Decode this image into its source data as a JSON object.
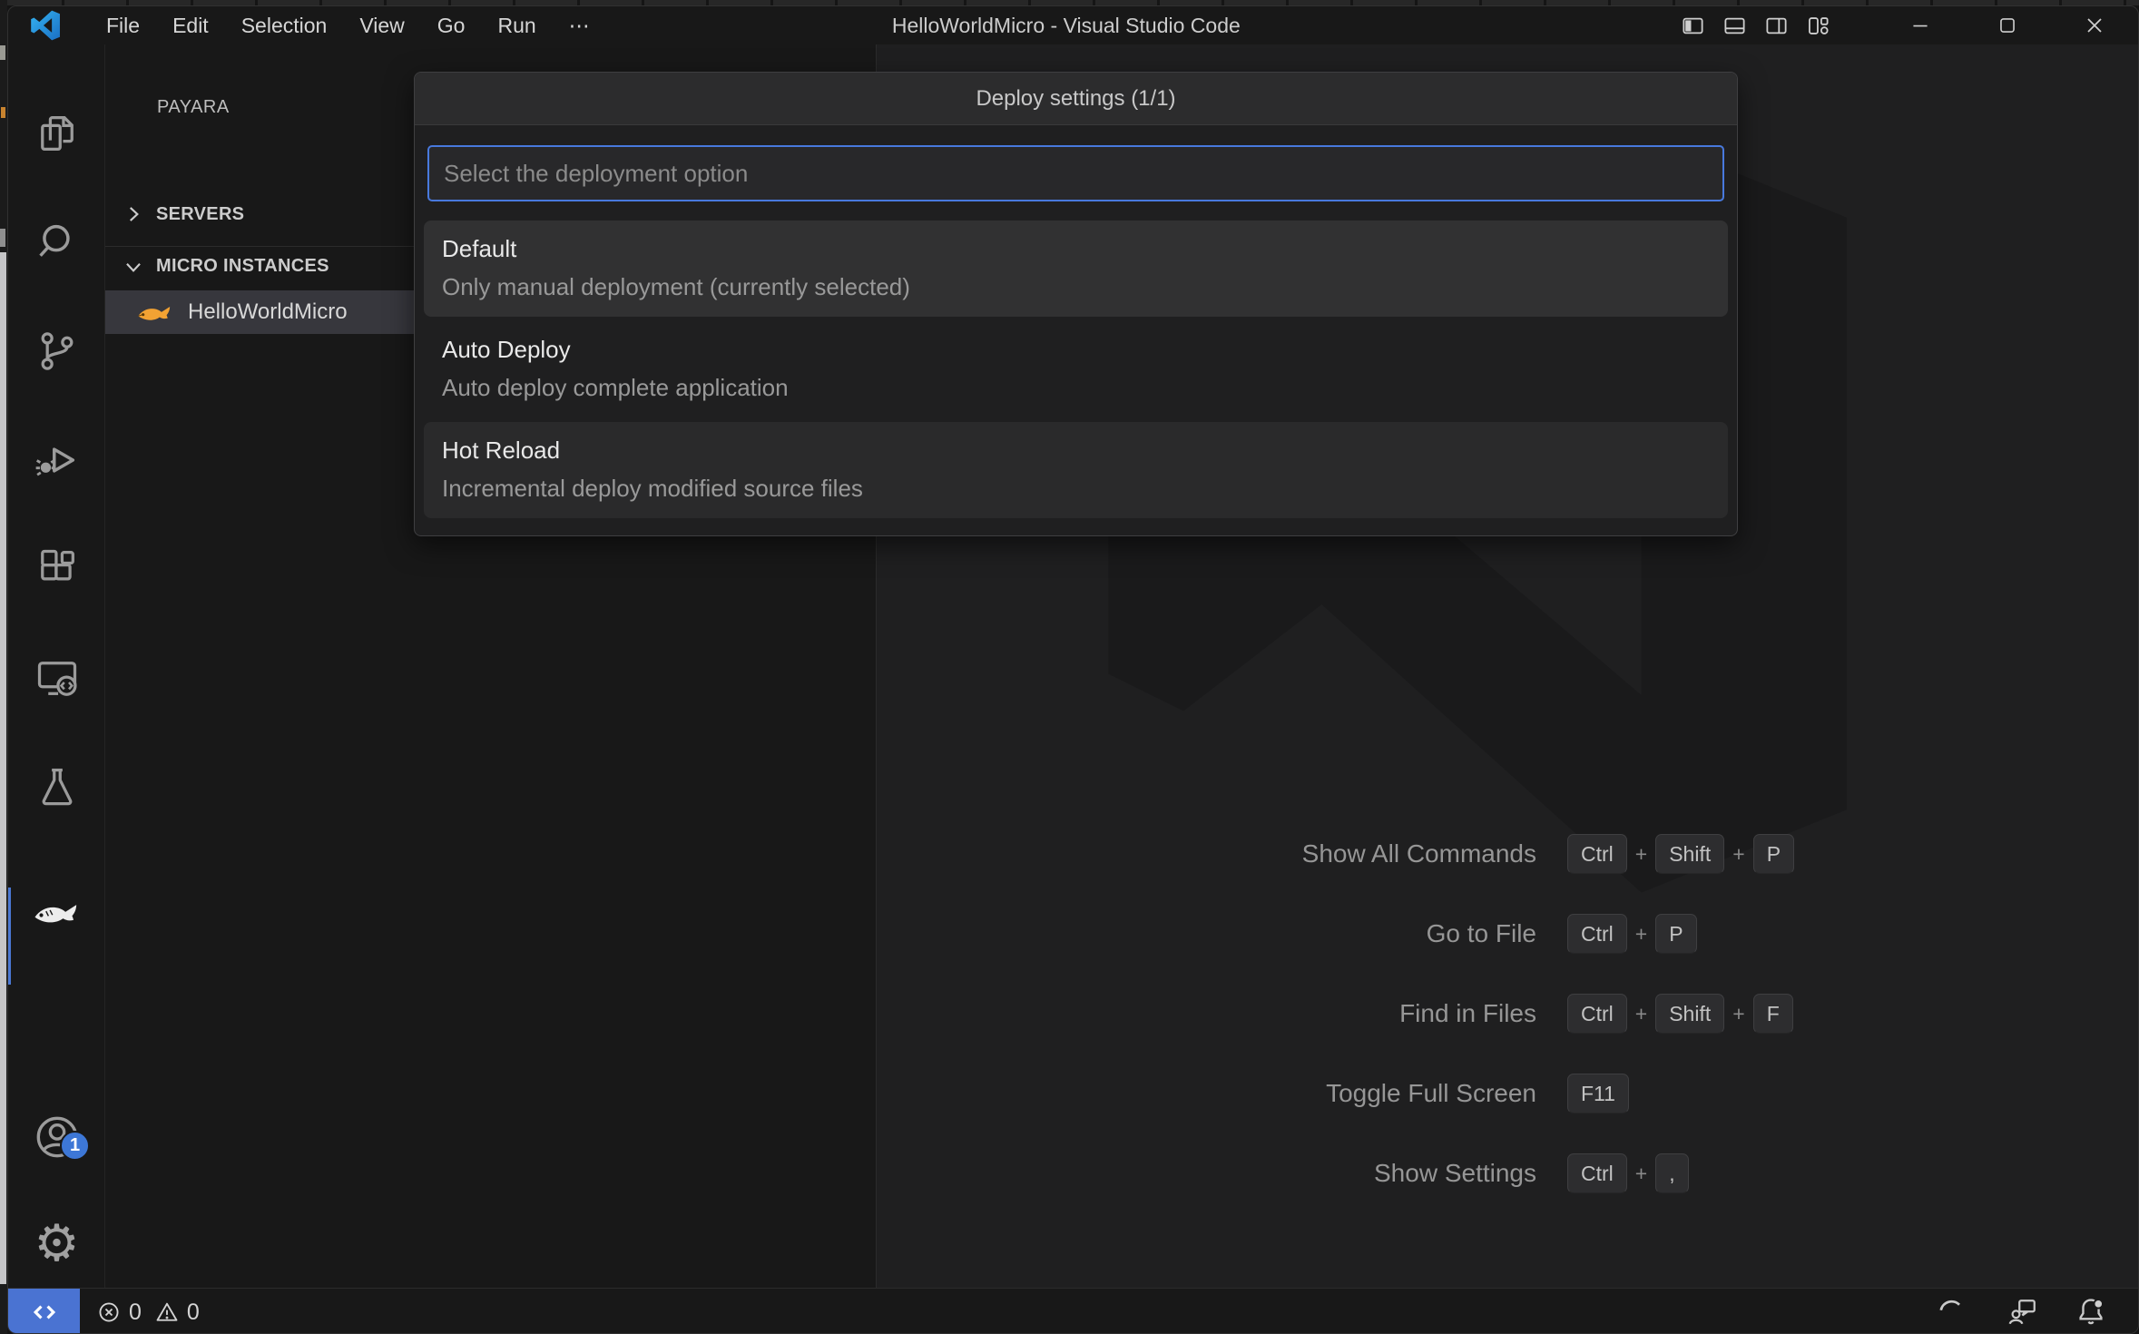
{
  "window": {
    "title": "HelloWorldMicro - Visual Studio Code"
  },
  "menu_bar": {
    "items": [
      "File",
      "Edit",
      "Selection",
      "View",
      "Go",
      "Run",
      "⋯"
    ]
  },
  "titlebar_controls": {
    "layout_icons": [
      "toggle-primary-sidebar",
      "toggle-panel",
      "toggle-secondary-sidebar",
      "customize-layout"
    ],
    "window_icons": [
      "minimize",
      "maximize",
      "close"
    ]
  },
  "activity_bar": {
    "items": [
      "explorer",
      "search",
      "source-control",
      "run-and-debug",
      "extensions",
      "remote-explorer",
      "testing",
      "payara"
    ],
    "active_item": "payara",
    "bottom_items": [
      "accounts",
      "settings"
    ],
    "accounts_badge": "1"
  },
  "sidebar": {
    "title": "PAYARA",
    "sections": [
      {
        "label": "SERVERS",
        "collapsed": true
      },
      {
        "label": "MICRO INSTANCES",
        "collapsed": false
      }
    ],
    "micro_instances": [
      {
        "label": "HelloWorldMicro",
        "selected": true
      }
    ]
  },
  "quick_pick": {
    "title": "Deploy settings (1/1)",
    "placeholder": "Select the deployment option",
    "items": [
      {
        "label": "Default",
        "description": "Only manual deployment (currently selected)",
        "state": "focused"
      },
      {
        "label": "Auto Deploy",
        "description": "Auto deploy complete application",
        "state": "default"
      },
      {
        "label": "Hot Reload",
        "description": "Incremental deploy modified source files",
        "state": "hover"
      }
    ]
  },
  "watermark": {
    "shortcuts": [
      {
        "label": "Show All Commands",
        "keys": [
          "Ctrl",
          "Shift",
          "P"
        ]
      },
      {
        "label": "Go to File",
        "keys": [
          "Ctrl",
          "P"
        ]
      },
      {
        "label": "Find in Files",
        "keys": [
          "Ctrl",
          "Shift",
          "F"
        ]
      },
      {
        "label": "Toggle Full Screen",
        "keys": [
          "F11"
        ]
      },
      {
        "label": "Show Settings",
        "keys": [
          "Ctrl",
          ","
        ]
      }
    ]
  },
  "status_bar": {
    "error_count": "0",
    "warning_count": "0",
    "right_icons": [
      "spinner",
      "feedback",
      "bell-dot"
    ]
  },
  "colors": {
    "accent_blue": "#4a73d2",
    "focus_border": "#4879dd",
    "list_selection": "#37373d",
    "payara_orange": "#f2a233",
    "editor_bg": "#1f1f20",
    "chrome_bg": "#181818"
  }
}
